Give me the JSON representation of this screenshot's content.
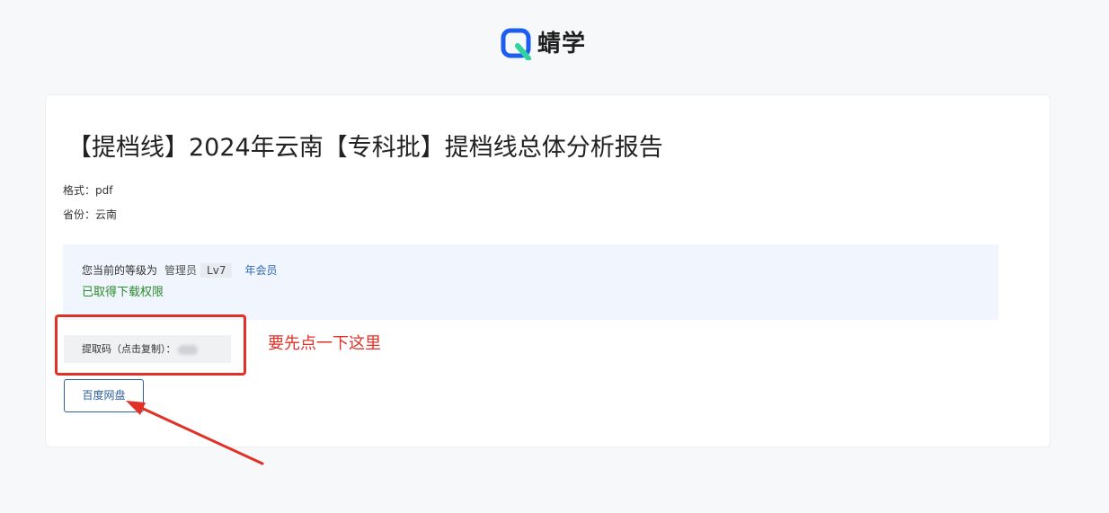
{
  "brand": {
    "name": "蜻学",
    "logo_icon": "q-logo-icon",
    "logo_colors": [
      "#1d5ef0",
      "#2fd49c"
    ]
  },
  "document": {
    "title": "【提档线】2024年云南【专科批】提档线总体分析报告",
    "format_line": "格式：pdf",
    "province_line": "省份：云南"
  },
  "membership": {
    "level_prefix": "您当前的等级为",
    "role": "管理员",
    "level_badge": "Lv7",
    "member_link": "年会员",
    "download_status": "已取得下载权限"
  },
  "extraction_code": {
    "label": "提取码（点击复制）：",
    "value_masked": true
  },
  "download_button": {
    "label": "百度网盘"
  },
  "annotation": {
    "note": "要先点一下这里",
    "color": "#e03127"
  }
}
